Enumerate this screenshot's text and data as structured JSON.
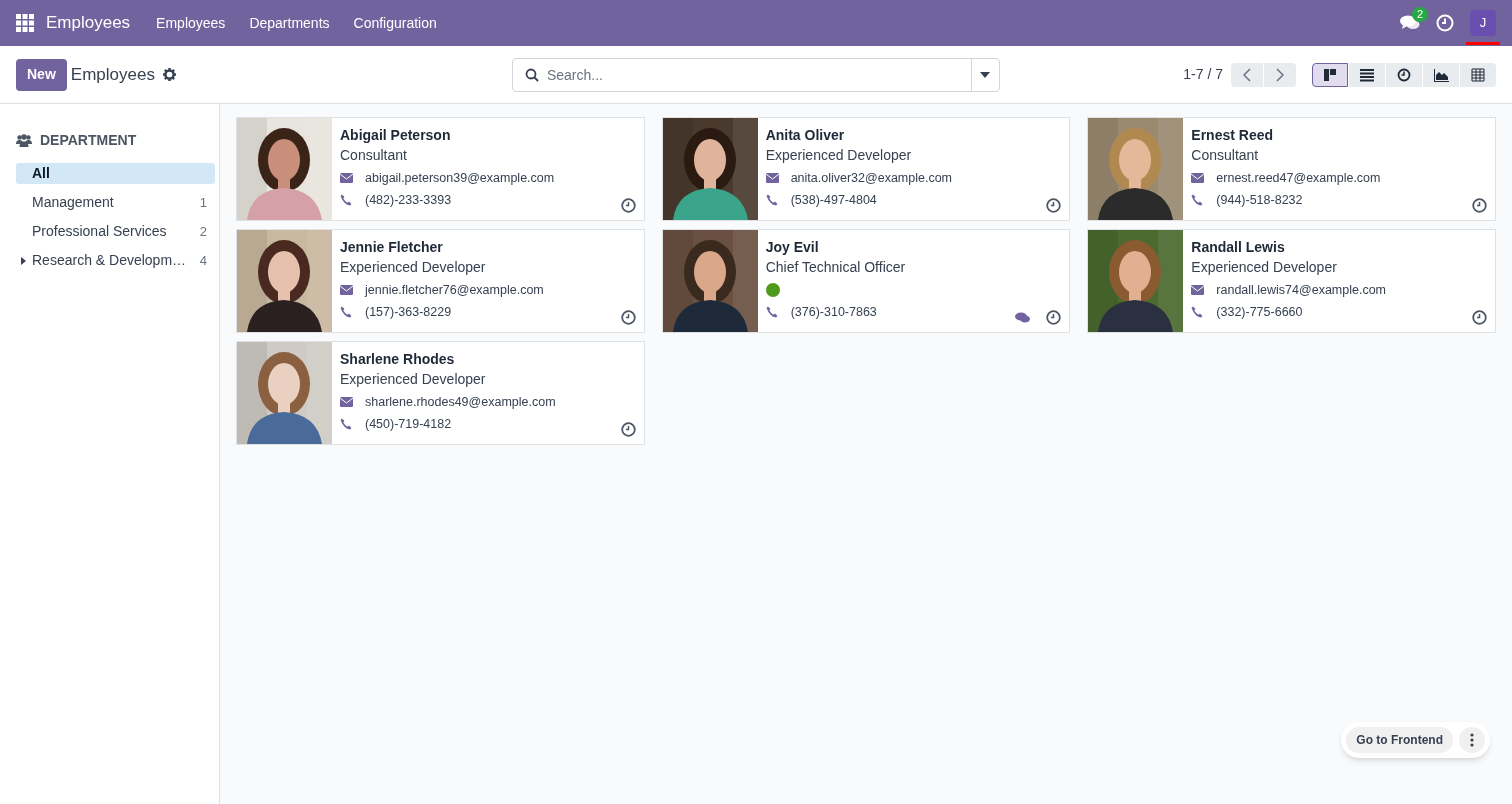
{
  "navbar": {
    "app_name": "Employees",
    "menu": [
      "Employees",
      "Departments",
      "Configuration"
    ],
    "messages_count": "2",
    "user_initial": "J"
  },
  "control_panel": {
    "new_button": "New",
    "title": "Employees",
    "search": {
      "placeholder": "Search..."
    },
    "pager": "1-7 / 7",
    "views": [
      {
        "kind": "kanban",
        "selected": true
      },
      {
        "kind": "list",
        "selected": false
      },
      {
        "kind": "activity",
        "selected": false
      },
      {
        "kind": "graph",
        "selected": false
      },
      {
        "kind": "pivot",
        "selected": false
      }
    ]
  },
  "sidebar": {
    "heading": "DEPARTMENT",
    "items": [
      {
        "label": "All",
        "selected": true
      },
      {
        "label": "Management",
        "count": "1",
        "selected": false
      },
      {
        "label": "Professional Services",
        "count": "2",
        "selected": false
      },
      {
        "label": "Research & Developm…",
        "count": "4",
        "selected": false,
        "expanded": false
      }
    ]
  },
  "employees": [
    {
      "name": "Abigail Peterson",
      "job": "Consultant",
      "email": "abigail.peterson39@example.com",
      "phone": "(482)-233-3393",
      "chat": false
    },
    {
      "name": "Anita Oliver",
      "job": "Experienced Developer",
      "email": "anita.oliver32@example.com",
      "phone": "(538)-497-4804",
      "chat": false
    },
    {
      "name": "Ernest Reed",
      "job": "Consultant",
      "email": "ernest.reed47@example.com",
      "phone": "(944)-518-8232",
      "chat": false
    },
    {
      "name": "Jennie Fletcher",
      "job": "Experienced Developer",
      "email": "jennie.fletcher76@example.com",
      "phone": "(157)-363-8229",
      "chat": false
    },
    {
      "name": "Joy Evil",
      "job": "Chief Technical Officer",
      "color": "#4e9a1a",
      "phone": "(376)-310-7863",
      "chat": true
    },
    {
      "name": "Randall Lewis",
      "job": "Experienced Developer",
      "email": "randall.lewis74@example.com",
      "phone": "(332)-775-6660",
      "chat": false
    },
    {
      "name": "Sharlene Rhodes",
      "job": "Experienced Developer",
      "email": "sharlene.rhodes49@example.com",
      "phone": "(450)-719-4182",
      "chat": false
    }
  ],
  "floating": {
    "button": "Go to Frontend"
  }
}
